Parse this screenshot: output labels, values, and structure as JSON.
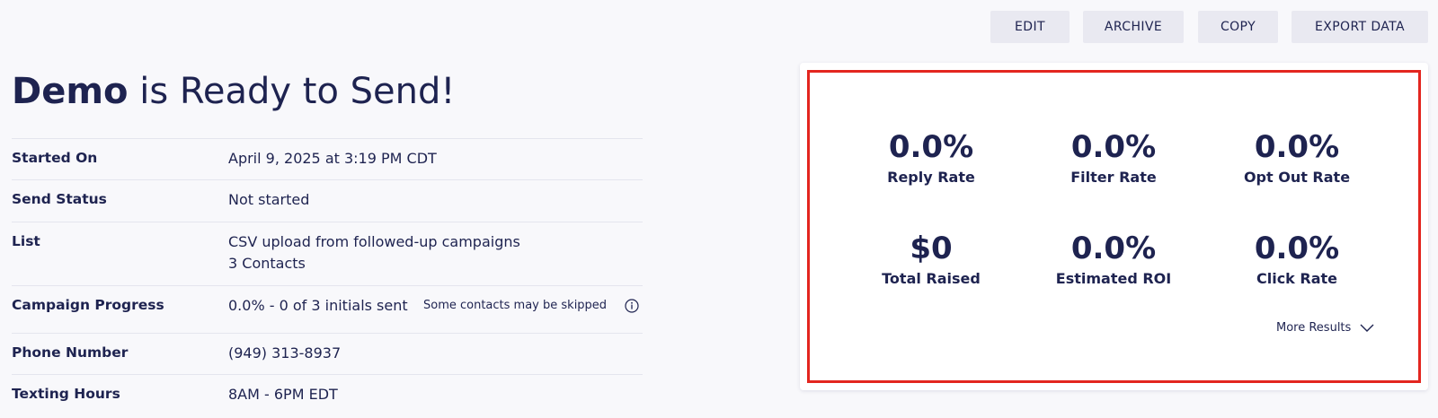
{
  "toolbar": {
    "edit_label": "EDIT",
    "archive_label": "ARCHIVE",
    "copy_label": "COPY",
    "export_label": "EXPORT DATA"
  },
  "title": {
    "name": "Demo",
    "suffix": " is Ready to Send!"
  },
  "details": [
    {
      "label": "Started On",
      "value": "April 9, 2025 at 3:19 PM CDT"
    },
    {
      "label": "Send Status",
      "value": "Not started"
    },
    {
      "label": "List",
      "value": "CSV upload from followed-up campaigns",
      "value2": "3 Contacts"
    },
    {
      "label": "Campaign Progress",
      "value": "0.0% - 0 of 3 initials sent",
      "note": "Some contacts may be skipped"
    },
    {
      "label": "Phone Number",
      "value": "(949) 313-8937"
    },
    {
      "label": "Texting Hours",
      "value": "8AM - 6PM EDT"
    }
  ],
  "metrics": [
    {
      "value": "0.0%",
      "label": "Reply Rate"
    },
    {
      "value": "0.0%",
      "label": "Filter Rate"
    },
    {
      "value": "0.0%",
      "label": "Opt Out Rate"
    },
    {
      "value": "$0",
      "label": "Total Raised"
    },
    {
      "value": "0.0%",
      "label": "Estimated ROI"
    },
    {
      "value": "0.0%",
      "label": "Click Rate"
    }
  ],
  "more_results_label": "More Results",
  "icons": {
    "info": "info-circle-icon",
    "chevron": "chevron-down-icon"
  },
  "colors": {
    "text": "#1e2350",
    "button_bg": "#e9e9f1",
    "highlight": "#e3261f"
  }
}
